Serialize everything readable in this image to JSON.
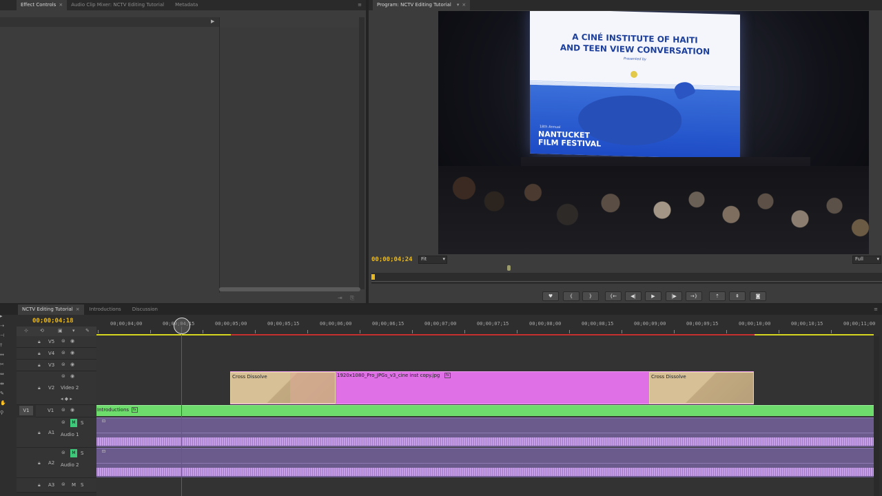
{
  "effect_panel": {
    "tabs": [
      {
        "label": "Effect Controls",
        "active": true
      },
      {
        "label": "Audio Clip Mixer: NCTV Editing Tutorial",
        "active": false
      },
      {
        "label": "Metadata",
        "active": false
      }
    ]
  },
  "program": {
    "tab_label": "Program: NCTV Editing Tutorial",
    "timecode": "00;00;04;24",
    "fit_label": "Fit",
    "quality_label": "Full",
    "screen": {
      "line1": "A CINÉ INSTITUTE OF HAITI",
      "line2": "AND TEEN VIEW CONVERSATION",
      "presented": "Presented by",
      "festival_num": "18th Annual",
      "festival_name1": "NANTUCKET",
      "festival_name2": "FILM FESTIVAL"
    }
  },
  "timeline": {
    "tabs": [
      {
        "label": "NCTV Editing Tutorial",
        "active": true
      },
      {
        "label": "Introductions",
        "active": false
      },
      {
        "label": "Discussion",
        "active": false
      }
    ],
    "timecode": "00;00;04;18",
    "ruler": [
      "00;00;04;00",
      "00;00;04;15",
      "00;00;05;00",
      "00;00;05;15",
      "00;00;06;00",
      "00;00;06;15",
      "00;00;07;00",
      "00;00;07;15",
      "00;00;08;00",
      "00;00;08;15",
      "00;00;09;00",
      "00;00;09;15",
      "00;00;10;00",
      "00;00;10;15",
      "00;00;11;00"
    ],
    "tracks": {
      "v5": "V5",
      "v4": "V4",
      "v3": "V3",
      "v2": "V2",
      "v2_name": "Video 2",
      "v1": "V1",
      "v1_src": "V1",
      "a1": "A1",
      "a1_name": "Audio 1",
      "a2": "A2",
      "a2_name": "Audio 2",
      "a3": "A3",
      "m": "M",
      "s": "S"
    },
    "clips": {
      "cross1": "Cross Dissolve",
      "pink": "1920x1080_Pro_JPGs_v3_cine inst copy.jpg",
      "fx_badge": "fx",
      "cross2": "Cross Dissolve",
      "intro": "Introductions"
    }
  }
}
